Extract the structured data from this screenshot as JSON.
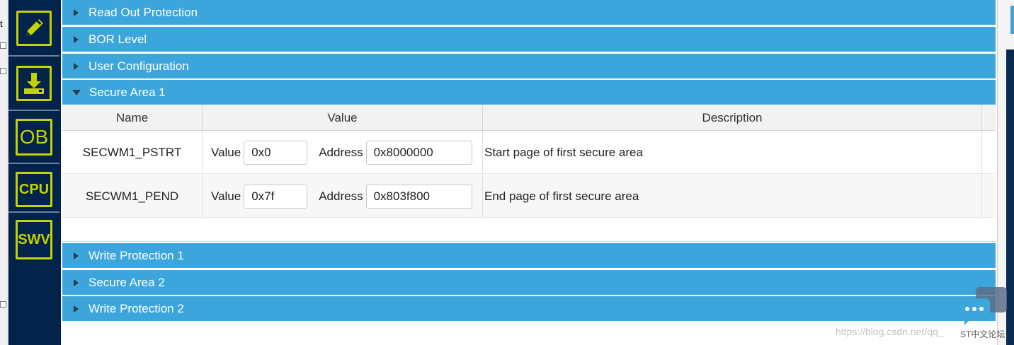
{
  "edge": {
    "fragment": "t"
  },
  "rail": {
    "tools": [
      {
        "name": "edit-icon",
        "label": ""
      },
      {
        "name": "download-icon",
        "label": ""
      },
      {
        "name": "ob-icon",
        "label": "OB"
      },
      {
        "name": "cpu-icon",
        "label": "CPU"
      },
      {
        "name": "swv-icon",
        "label": "SWV"
      }
    ],
    "accent": "#c3d200",
    "background": "#03234b"
  },
  "sections": [
    {
      "label": "Read Out Protection",
      "expanded": false
    },
    {
      "label": "BOR Level",
      "expanded": false
    },
    {
      "label": "User Configuration",
      "expanded": false
    },
    {
      "label": "Secure Area 1",
      "expanded": true
    },
    {
      "label": "Write Protection 1",
      "expanded": false
    },
    {
      "label": "Secure Area 2",
      "expanded": false
    },
    {
      "label": "Write Protection 2",
      "expanded": false
    }
  ],
  "table": {
    "headers": {
      "name": "Name",
      "value": "Value",
      "description": "Description"
    },
    "rows": [
      {
        "name": "SECWM1_PSTRT",
        "value_label": "Value",
        "value": "0x0",
        "address_label": "Address",
        "address": "0x8000000",
        "description": "Start page of first secure area"
      },
      {
        "name": "SECWM1_PEND",
        "value_label": "Value",
        "value": "0x7f",
        "address_label": "Address",
        "address": "0x803f800",
        "description": "End page of first secure area"
      }
    ]
  },
  "colors": {
    "section_bar": "#3ca6dc",
    "header_bg": "#f2f2f2"
  },
  "watermark": {
    "url": "https://blog.csdn.net/qq_",
    "tag": "ST中文论坛"
  }
}
